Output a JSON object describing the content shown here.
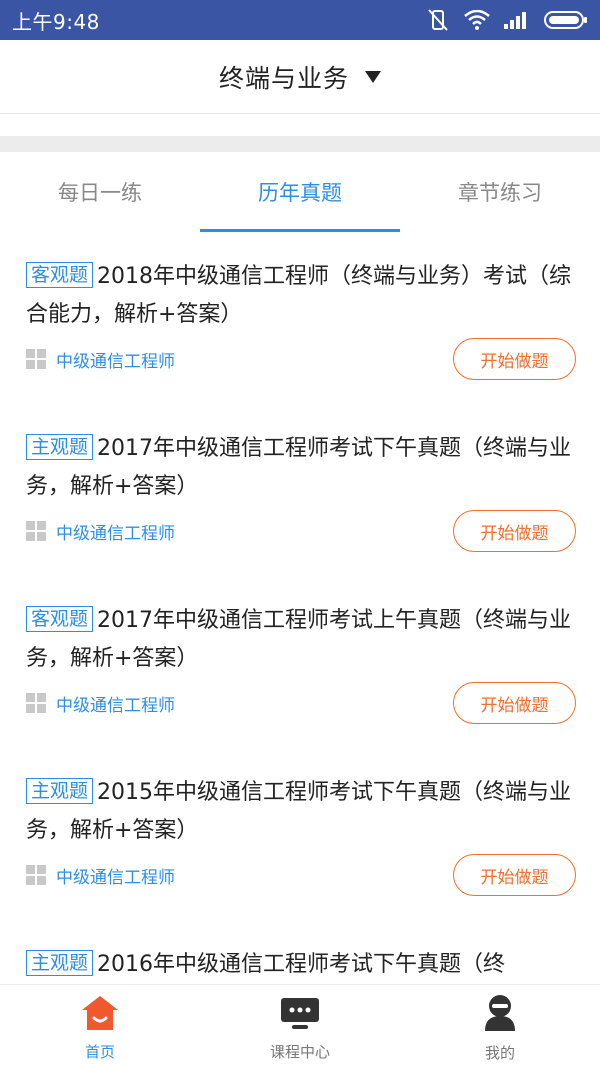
{
  "status_bar": {
    "time": "上午9:48"
  },
  "header": {
    "title": "终端与业务"
  },
  "tabs": [
    {
      "label": "每日一练",
      "active": false
    },
    {
      "label": "历年真题",
      "active": true
    },
    {
      "label": "章节练习",
      "active": false
    }
  ],
  "list": [
    {
      "tag": "客观题",
      "title": "2018年中级通信工程师（终端与业务）考试（综合能力，解析+答案）",
      "category": "中级通信工程师",
      "button": "开始做题"
    },
    {
      "tag": "主观题",
      "title": "2017年中级通信工程师考试下午真题（终端与业务，解析+答案）",
      "category": "中级通信工程师",
      "button": "开始做题"
    },
    {
      "tag": "客观题",
      "title": "2017年中级通信工程师考试上午真题（终端与业务，解析+答案）",
      "category": "中级通信工程师",
      "button": "开始做题"
    },
    {
      "tag": "主观题",
      "title": "2015年中级通信工程师考试下午真题（终端与业务，解析+答案）",
      "category": "中级通信工程师",
      "button": "开始做题"
    },
    {
      "tag": "主观题",
      "title": "2016年中级通信工程师考试下午真题（终",
      "category": "",
      "button": ""
    }
  ],
  "bottom_nav": [
    {
      "label": "首页",
      "icon": "home-icon",
      "active": true
    },
    {
      "label": "课程中心",
      "icon": "course-icon",
      "active": false
    },
    {
      "label": "我的",
      "icon": "profile-icon",
      "active": false
    }
  ],
  "colors": {
    "status_bar": "#3a55a4",
    "accent": "#2d8ee6",
    "button": "#f0702e",
    "home_icon": "#f0582e"
  }
}
